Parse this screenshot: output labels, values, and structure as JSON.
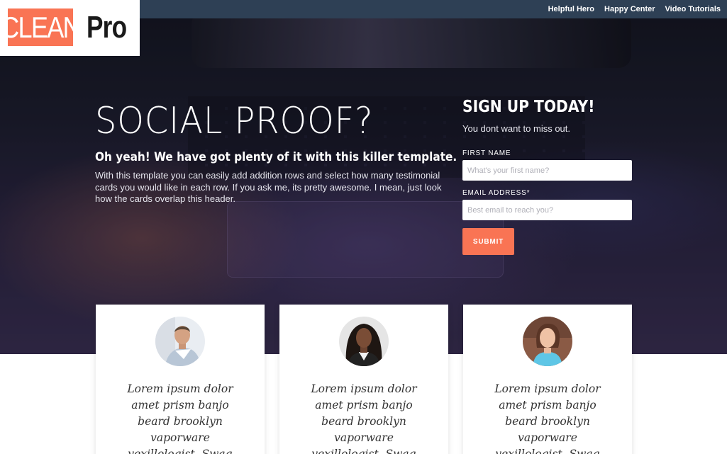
{
  "nav": {
    "links": [
      "Helpful Hero",
      "Happy Center",
      "Video Tutorials"
    ]
  },
  "logo": {
    "part1": "CLEAN",
    "part2": "Pro"
  },
  "hero": {
    "title": "SOCIAL PROOF?",
    "subtitle": "Oh yeah! We have got plenty of it with this killer template.",
    "body": "With this template you can easily add addition rows and select how many testimonial cards you would like in each row. If you ask me, its pretty awesome. I mean, just look how the cards overlap this header."
  },
  "signup": {
    "title": "SIGN UP TODAY!",
    "subtitle": "You dont want to miss out.",
    "first_name_label": "FIRST NAME",
    "first_name_placeholder": "What's your first name?",
    "first_name_value": "",
    "email_label": "EMAIL ADDRESS*",
    "email_placeholder": "Best email to reach you?",
    "email_value": "",
    "submit_label": "SUBMIT"
  },
  "cards": [
    {
      "quote": "Lorem ipsum dolor amet prism banjo beard brooklyn vaporware vexillologist. Swag"
    },
    {
      "quote": "Lorem ipsum dolor amet prism banjo beard brooklyn vaporware vexillologist. Swag"
    },
    {
      "quote": "Lorem ipsum dolor amet prism banjo beard brooklyn vaporware vexillologist. Swag"
    }
  ],
  "colors": {
    "accent": "#f97454",
    "topbar": "#2e4055",
    "hero_dark": "#1c1d2c"
  }
}
